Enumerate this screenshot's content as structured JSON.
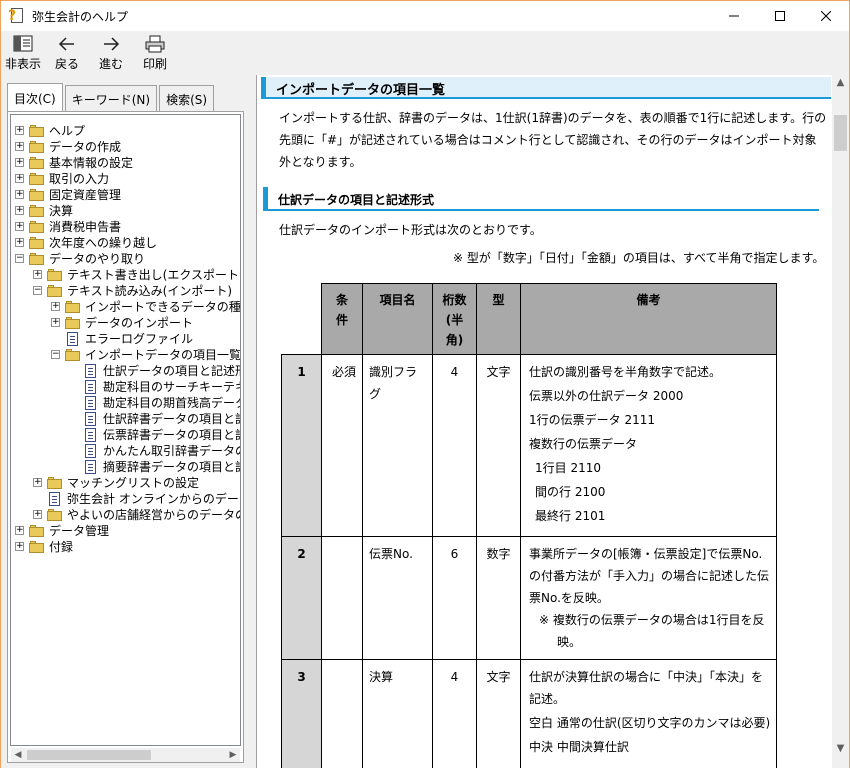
{
  "window": {
    "title": "弥生会計のヘルプ",
    "controls": [
      "—",
      "☐",
      "✕"
    ]
  },
  "toolbar": {
    "hide_label": "非表示",
    "back_label": "戻る",
    "forward_label": "進む",
    "print_label": "印刷"
  },
  "tabs": [
    {
      "label": "目次(C)"
    },
    {
      "label": "キーワード(N)"
    },
    {
      "label": "検索(S)"
    }
  ],
  "tree": {
    "items": [
      {
        "label": "ヘルプ"
      },
      {
        "label": "データの作成"
      },
      {
        "label": "基本情報の設定"
      },
      {
        "label": "取引の入力"
      },
      {
        "label": "固定資産管理"
      },
      {
        "label": "決算"
      },
      {
        "label": "消費税申告書"
      },
      {
        "label": "次年度への繰り越し"
      },
      {
        "label": "データのやり取り"
      },
      {
        "label": "テキスト書き出し(エクスポート)"
      },
      {
        "label": "テキスト読み込み(インポート)"
      },
      {
        "label": "インポートできるデータの種類"
      },
      {
        "label": "データのインポート"
      },
      {
        "label": "エラーログファイル"
      },
      {
        "label": "インポートデータの項目一覧"
      },
      {
        "label": "仕訳データの項目と記述形式"
      },
      {
        "label": "勘定科目のサーチキーテキスト"
      },
      {
        "label": "勘定科目の期首残高データ"
      },
      {
        "label": "仕訳辞書データの項目と記述"
      },
      {
        "label": "伝票辞書データの項目と記述"
      },
      {
        "label": "かんたん取引辞書データの項目"
      },
      {
        "label": "摘要辞書データの項目と記述"
      },
      {
        "label": "マッチングリストの設定"
      },
      {
        "label": "弥生会計 オンラインからのデータ"
      },
      {
        "label": "やよいの店舗経営からのデータの"
      },
      {
        "label": "データ管理"
      },
      {
        "label": "付録"
      }
    ]
  },
  "content": {
    "heading": "インポートデータの項目一覧",
    "intro": "インポートする仕訳、辞書のデータは、1仕訳(1辞書)のデータを、表の順番で1行に記述します。行の先頭に「#」が記述されている場合はコメント行として認識され、その行のデータはインポート対象外となります。",
    "section_heading": "仕訳データの項目と記述形式",
    "section_text": "仕訳データのインポート形式は次のとおりです。",
    "note": "※ 型が「数字」「日付」「金額」の項目は、すべて半角で指定します。",
    "table": {
      "headers": {
        "cond": "条件",
        "name": "項目名",
        "digits": "桁数(半角)",
        "type": "型",
        "memo": "備考"
      },
      "rows": [
        {
          "no": "1",
          "cond": "必須",
          "name": "識別フラグ",
          "digits": "4",
          "type": "文字",
          "memo1": "仕訳の識別番号を半角数字で記述。",
          "memo2": "伝票以外の仕訳データ 2000",
          "memo3": "1行の伝票データ 2111",
          "memo4": "複数行の伝票データ",
          "memo5": "1行目 2110",
          "memo6": "間の行 2100",
          "memo7": "最終行 2101"
        },
        {
          "no": "2",
          "cond": "",
          "name": "伝票No.",
          "digits": "6",
          "type": "数字",
          "memo1": "事業所データの[帳簿・伝票設定]で伝票No.の付番方法が「手入力」の場合に記述した伝票No.を反映。",
          "memo2": "※ 複数行の伝票データの場合は1行目を反映。"
        },
        {
          "no": "3",
          "cond": "",
          "name": "決算",
          "digits": "4",
          "type": "文字",
          "memo1": "仕訳が決算仕訳の場合に「中決」「本決」を記述。",
          "memo2": "空白 通常の仕訳(区切り文字のカンマは必要)",
          "memo3": "中決 中間決算仕訳"
        }
      ]
    }
  }
}
